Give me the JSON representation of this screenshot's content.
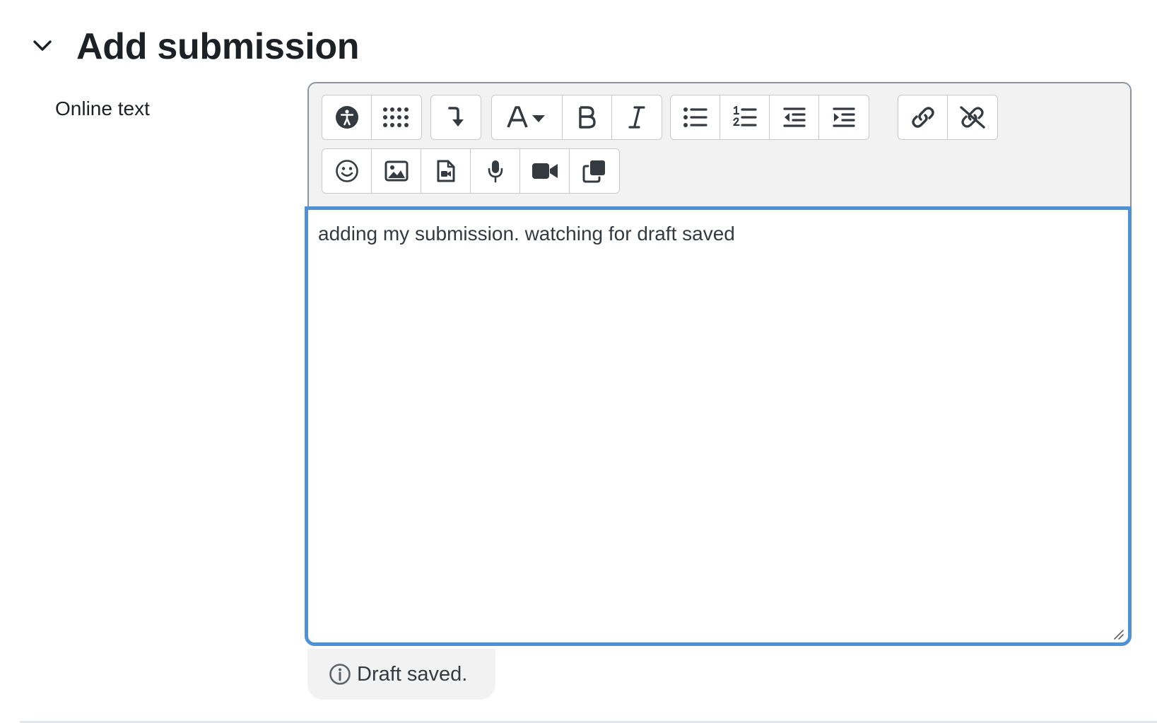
{
  "section": {
    "title": "Add submission",
    "toggle_icon": "chevron-down-icon"
  },
  "field": {
    "label": "Online text"
  },
  "editor": {
    "toolbar_row1": [
      [
        "accessibility-checker-icon",
        "tile-grid-icon"
      ],
      [
        "arrow-turn-down-icon"
      ],
      [
        "font-style-dropdown-icon",
        "bold-icon",
        "italic-icon"
      ],
      [
        "unordered-list-icon",
        "ordered-list-icon",
        "outdent-icon",
        "indent-icon"
      ],
      [
        "link-icon",
        "unlink-icon"
      ]
    ],
    "toolbar_row2": [
      [
        "emoji-icon",
        "image-icon",
        "media-file-icon",
        "microphone-icon",
        "video-camera-icon",
        "copy-icon"
      ]
    ],
    "content": "adding my submission. watching for draft saved",
    "focus_color": "#4e91d6"
  },
  "status": {
    "text": "Draft saved.",
    "icon": "info-icon"
  }
}
